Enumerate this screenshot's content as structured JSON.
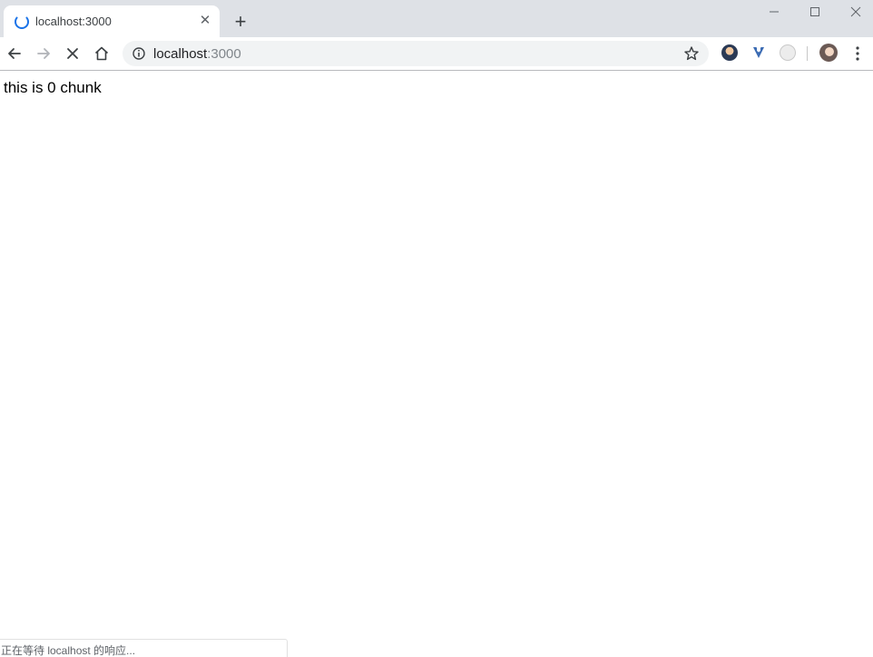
{
  "tab": {
    "title": "localhost:3000",
    "close_glyph": "✕",
    "icon": "loading-spinner-icon"
  },
  "new_tab_glyph": "+",
  "toolbar": {
    "icons": [
      "back-arrow-icon",
      "forward-arrow-icon",
      "stop-loading-icon",
      "home-icon"
    ]
  },
  "omnibox": {
    "host": "localhost",
    "port": ":3000",
    "left_icon": "info-icon",
    "right_icon": "bookmark-star-icon"
  },
  "extensions": [
    "extension-avatar-icon",
    "extension-v-icon",
    "extension-circle-icon"
  ],
  "profile_icon": "profile-avatar-icon",
  "page": {
    "text": "this is 0 chunk"
  },
  "status": {
    "text": "正在等待 localhost 的响应..."
  },
  "colors": {
    "tabstrip": "#dee1e6",
    "omnibox": "#f1f3f4",
    "accent": "#1a73e8"
  }
}
